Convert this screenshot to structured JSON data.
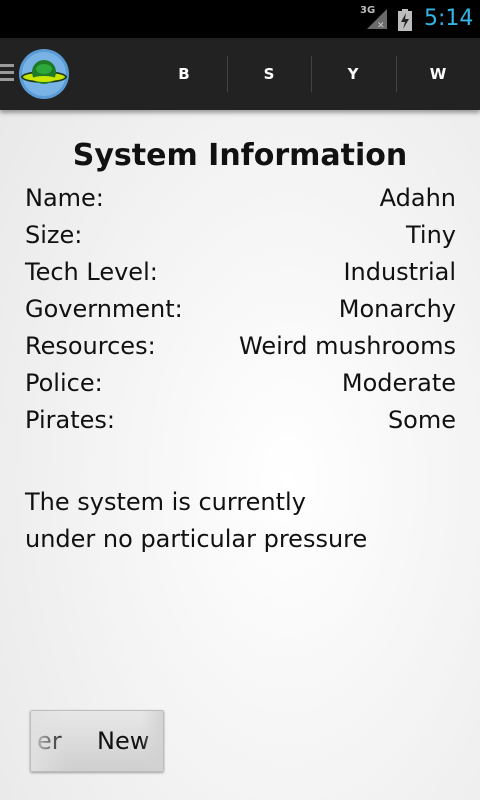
{
  "status_bar": {
    "network": "3G",
    "time": "5:14"
  },
  "action_bar": {
    "tabs": [
      "B",
      "S",
      "Y",
      "W"
    ]
  },
  "system_info": {
    "title": "System Information",
    "rows": [
      {
        "label": "Name:",
        "value": "Adahn"
      },
      {
        "label": "Size:",
        "value": "Tiny"
      },
      {
        "label": "Tech Level:",
        "value": "Industrial"
      },
      {
        "label": "Government:",
        "value": "Monarchy"
      },
      {
        "label": "Resources:",
        "value": "Weird mushrooms"
      },
      {
        "label": "Police:",
        "value": "Moderate"
      },
      {
        "label": "Pirates:",
        "value": "Some"
      }
    ],
    "status_line1": "The system is currently",
    "status_line2": "under no particular pressure"
  },
  "buttons": {
    "partial_label": "er",
    "new_label": "New"
  },
  "colors": {
    "clock": "#33b5e5",
    "action_bar": "#222222",
    "status_bar": "#000000"
  }
}
